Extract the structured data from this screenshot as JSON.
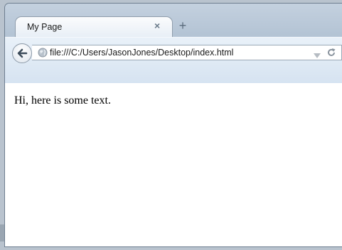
{
  "tab": {
    "title": "My Page",
    "close_glyph": "×"
  },
  "new_tab_glyph": "+",
  "urlbar": {
    "url": "file:///C:/Users/JasonJones/Desktop/index.html"
  },
  "page": {
    "text": "Hi, here is some text."
  },
  "icons": {
    "back": "back-arrow-icon",
    "site": "globe-icon",
    "history": "dropdown-arrow-icon",
    "reload": "reload-icon"
  },
  "colors": {
    "tabstrip": "#b9c9da",
    "navbar": "#dbe7f3",
    "content_bg": "#ffffff"
  }
}
